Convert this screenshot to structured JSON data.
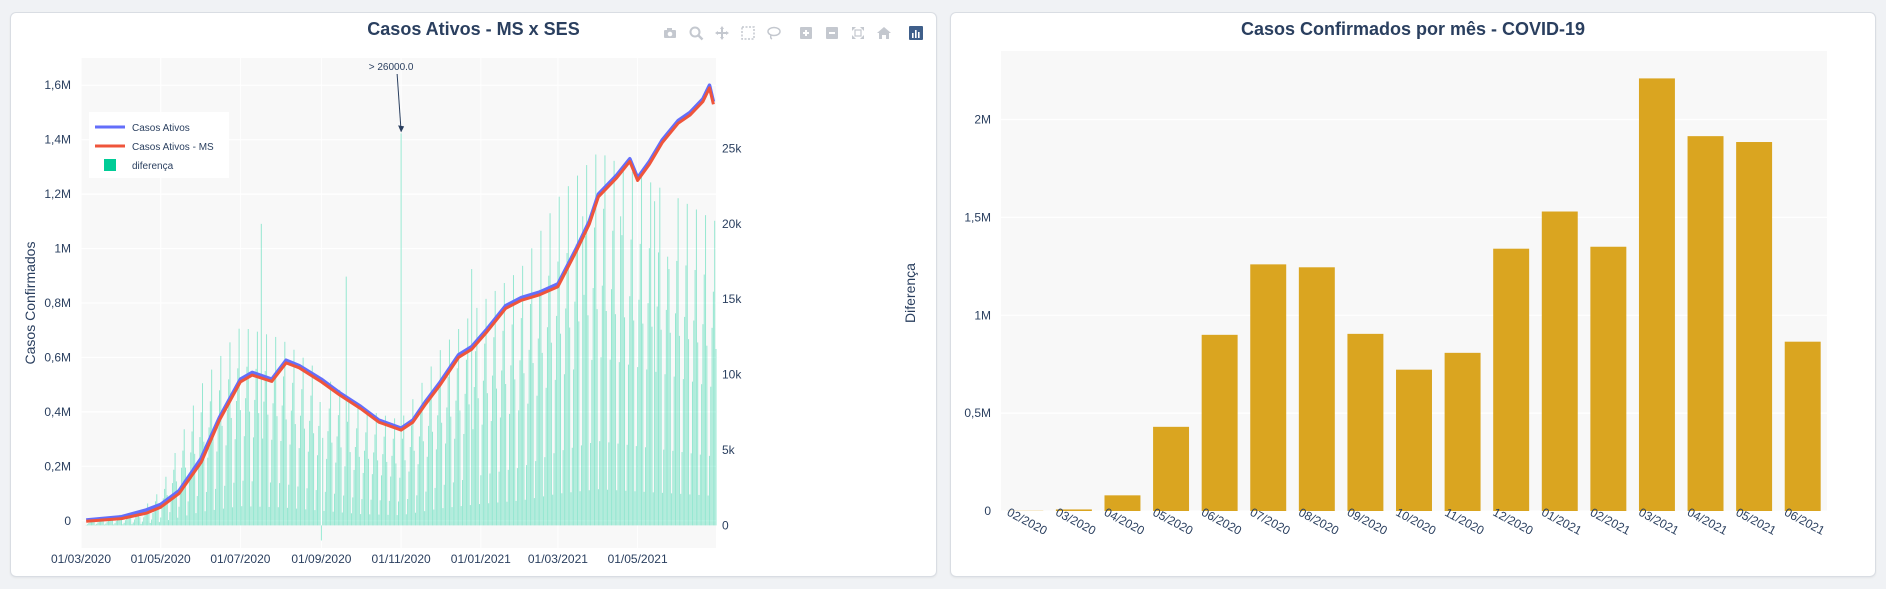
{
  "left_panel": {
    "title": "Casos Ativos - MS x SES",
    "modebar": [
      {
        "name": "camera-icon"
      },
      {
        "name": "zoom-icon"
      },
      {
        "name": "pan-icon"
      },
      {
        "name": "box-select-icon"
      },
      {
        "name": "lasso-select-icon"
      },
      {
        "name": "zoom-in-icon"
      },
      {
        "name": "zoom-out-icon"
      },
      {
        "name": "autoscale-icon"
      },
      {
        "name": "reset-axes-icon"
      },
      {
        "name": "plotly-logo-icon"
      }
    ]
  },
  "right_panel": {
    "title": "Casos Confirmados por mês - COVID-19"
  },
  "colors": {
    "casos_ativos": "#636efa",
    "casos_ativos_ms": "#ef553b",
    "diferenca": "#00cc96",
    "bars": "#daa520",
    "title": "#2a3f5f",
    "plot_bg": "#f8f8f8"
  },
  "chart_data": [
    {
      "type": "line",
      "title": "Casos Ativos - MS x SES",
      "xlabel": "",
      "ylabel": "Casos Confirmados",
      "y2label": "Diferença",
      "x_range": [
        "2020-03-01",
        "2021-06-30"
      ],
      "x_tick_labels": [
        "01/03/2020",
        "01/05/2020",
        "01/07/2020",
        "01/09/2020",
        "01/11/2020",
        "01/01/2021",
        "01/03/2021",
        "01/05/2021"
      ],
      "ylim": [
        -100000,
        1700000
      ],
      "y_tick_labels": [
        "0",
        "0,2M",
        "0,4M",
        "0,6M",
        "0,8M",
        "1M",
        "1,2M",
        "1,4M",
        "1,6M"
      ],
      "y_tick_values": [
        0,
        200000,
        400000,
        600000,
        800000,
        1000000,
        1200000,
        1400000,
        1600000
      ],
      "y2lim": [
        -1500,
        31000
      ],
      "y2_tick_labels": [
        "0",
        "5k",
        "10k",
        "15k",
        "20k",
        "25k"
      ],
      "y2_tick_values": [
        0,
        5000,
        10000,
        15000,
        20000,
        25000
      ],
      "legend_position": "top-left",
      "grid": true,
      "annotation": {
        "text": "> 26000.0",
        "x": "2020-11-01",
        "y2": 26000
      },
      "series": [
        {
          "name": "Casos Ativos",
          "axis": "y",
          "points": [
            [
              "2020-03-05",
              3000
            ],
            [
              "2020-04-01",
              15000
            ],
            [
              "2020-04-20",
              40000
            ],
            [
              "2020-05-01",
              60000
            ],
            [
              "2020-05-15",
              110000
            ],
            [
              "2020-06-01",
              230000
            ],
            [
              "2020-06-15",
              380000
            ],
            [
              "2020-07-01",
              520000
            ],
            [
              "2020-07-10",
              545000
            ],
            [
              "2020-07-25",
              520000
            ],
            [
              "2020-08-05",
              590000
            ],
            [
              "2020-08-15",
              570000
            ],
            [
              "2020-09-01",
              520000
            ],
            [
              "2020-09-15",
              470000
            ],
            [
              "2020-10-01",
              420000
            ],
            [
              "2020-10-15",
              370000
            ],
            [
              "2020-11-01",
              340000
            ],
            [
              "2020-11-10",
              370000
            ],
            [
              "2020-11-20",
              440000
            ],
            [
              "2020-12-01",
              510000
            ],
            [
              "2020-12-15",
              610000
            ],
            [
              "2020-12-25",
              640000
            ],
            [
              "2021-01-05",
              700000
            ],
            [
              "2021-01-20",
              790000
            ],
            [
              "2021-02-01",
              820000
            ],
            [
              "2021-02-15",
              840000
            ],
            [
              "2021-03-01",
              870000
            ],
            [
              "2021-03-15",
              1000000
            ],
            [
              "2021-03-25",
              1100000
            ],
            [
              "2021-04-01",
              1200000
            ],
            [
              "2021-04-15",
              1270000
            ],
            [
              "2021-04-25",
              1330000
            ],
            [
              "2021-05-01",
              1260000
            ],
            [
              "2021-05-10",
              1320000
            ],
            [
              "2021-05-20",
              1400000
            ],
            [
              "2021-06-01",
              1470000
            ],
            [
              "2021-06-10",
              1500000
            ],
            [
              "2021-06-20",
              1550000
            ],
            [
              "2021-06-25",
              1600000
            ],
            [
              "2021-06-28",
              1540000
            ]
          ]
        },
        {
          "name": "Casos Ativos - MS",
          "axis": "y",
          "points": [
            [
              "2020-03-05",
              -2000
            ],
            [
              "2020-04-01",
              8000
            ],
            [
              "2020-04-20",
              28000
            ],
            [
              "2020-05-01",
              50000
            ],
            [
              "2020-05-15",
              100000
            ],
            [
              "2020-06-01",
              215000
            ],
            [
              "2020-06-15",
              370000
            ],
            [
              "2020-07-01",
              510000
            ],
            [
              "2020-07-10",
              535000
            ],
            [
              "2020-07-25",
              512000
            ],
            [
              "2020-08-05",
              580000
            ],
            [
              "2020-08-15",
              562000
            ],
            [
              "2020-09-01",
              510000
            ],
            [
              "2020-09-15",
              462000
            ],
            [
              "2020-10-01",
              412000
            ],
            [
              "2020-10-15",
              362000
            ],
            [
              "2020-11-01",
              333000
            ],
            [
              "2020-11-10",
              362000
            ],
            [
              "2020-11-20",
              430000
            ],
            [
              "2020-12-01",
              500000
            ],
            [
              "2020-12-15",
              600000
            ],
            [
              "2020-12-25",
              630000
            ],
            [
              "2021-01-05",
              690000
            ],
            [
              "2021-01-20",
              780000
            ],
            [
              "2021-02-01",
              810000
            ],
            [
              "2021-02-15",
              830000
            ],
            [
              "2021-03-01",
              860000
            ],
            [
              "2021-03-15",
              990000
            ],
            [
              "2021-03-25",
              1090000
            ],
            [
              "2021-04-01",
              1190000
            ],
            [
              "2021-04-15",
              1260000
            ],
            [
              "2021-04-25",
              1320000
            ],
            [
              "2021-05-01",
              1250000
            ],
            [
              "2021-05-10",
              1310000
            ],
            [
              "2021-05-20",
              1390000
            ],
            [
              "2021-06-01",
              1460000
            ],
            [
              "2021-06-10",
              1490000
            ],
            [
              "2021-06-20",
              1540000
            ],
            [
              "2021-06-25",
              1590000
            ],
            [
              "2021-06-28",
              1530000
            ]
          ]
        },
        {
          "name": "diferença",
          "axis": "y2",
          "type": "bar",
          "daily_start": "2020-03-05",
          "daily_end": "2021-06-30",
          "trend": [
            [
              "2020-03-05",
              200
            ],
            [
              "2020-04-15",
              600
            ],
            [
              "2020-05-01",
              1500
            ],
            [
              "2020-06-01",
              6000
            ],
            [
              "2020-07-01",
              8500
            ],
            [
              "2020-08-01",
              8000
            ],
            [
              "2020-09-01",
              6500
            ],
            [
              "2020-10-01",
              5000
            ],
            [
              "2020-11-01",
              4500
            ],
            [
              "2020-12-01",
              7500
            ],
            [
              "2021-01-01",
              9500
            ],
            [
              "2021-02-01",
              11000
            ],
            [
              "2021-03-01",
              14000
            ],
            [
              "2021-04-01",
              16000
            ],
            [
              "2021-05-01",
              15000
            ],
            [
              "2021-06-01",
              14000
            ],
            [
              "2021-06-30",
              13000
            ]
          ],
          "spikes": [
            [
              "2020-07-17",
              20000
            ],
            [
              "2020-09-01",
              -1000
            ],
            [
              "2020-09-20",
              16500
            ],
            [
              "2020-11-01",
              26000
            ],
            [
              "2020-12-25",
              17000
            ],
            [
              "2021-03-20",
              20500
            ],
            [
              "2021-04-05",
              21000
            ],
            [
              "2021-04-18",
              20500
            ],
            [
              "2021-05-14",
              21500
            ],
            [
              "2021-05-25",
              17000
            ],
            [
              "2021-06-28",
              15500
            ]
          ]
        }
      ]
    },
    {
      "type": "bar",
      "title": "Casos Confirmados por mês - COVID-19",
      "xlabel": "",
      "ylabel": "",
      "categories": [
        "02/2020",
        "03/2020",
        "04/2020",
        "05/2020",
        "06/2020",
        "07/2020",
        "08/2020",
        "09/2020",
        "10/2020",
        "11/2020",
        "12/2020",
        "01/2021",
        "02/2021",
        "03/2021",
        "04/2021",
        "05/2021",
        "06/2021"
      ],
      "values": [
        1000,
        8000,
        80000,
        430000,
        900000,
        1260000,
        1245000,
        905000,
        722000,
        808000,
        1340000,
        1530000,
        1350000,
        2210000,
        1915000,
        1885000,
        865000
      ],
      "ylim": [
        0,
        2350000
      ],
      "y_tick_labels": [
        "0",
        "0,5M",
        "1M",
        "1,5M",
        "2M"
      ],
      "y_tick_values": [
        0,
        500000,
        1000000,
        1500000,
        2000000
      ],
      "grid": true
    }
  ]
}
